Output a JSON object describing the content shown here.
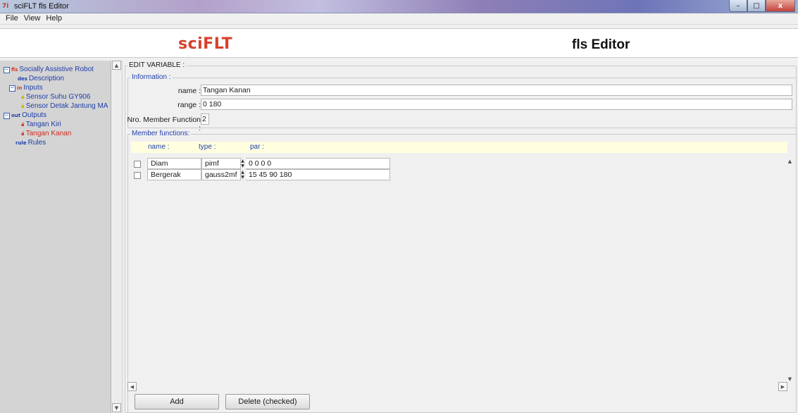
{
  "window": {
    "title": "sciFLT fls Editor",
    "min": "–",
    "max": "□",
    "close": "x"
  },
  "menu": [
    "File",
    "View",
    "Help"
  ],
  "banner": {
    "brand": "sciFLT",
    "editor_title": "fls Editor"
  },
  "tree": {
    "root": {
      "icon": "fls",
      "label": "Socially Assistive Robot"
    },
    "description": {
      "icon": "des",
      "label": "Description"
    },
    "inputs": {
      "icon": "in",
      "label": "Inputs"
    },
    "input_items": [
      "Sensor Suhu GY906",
      "Sensor Detak Jantung MA"
    ],
    "outputs": {
      "icon": "out",
      "label": "Outputs"
    },
    "output_items": [
      "Tangan Kiri",
      "Tangan Kanan"
    ],
    "rules": {
      "icon": "rule",
      "label": "Rules"
    }
  },
  "editor": {
    "section": "EDIT VARIABLE :",
    "information": "Information :",
    "name_label": "name :",
    "name_value": "Tangan Kanan",
    "range_label": "range :",
    "range_value": "0 180",
    "nmf_label": "Nro. Member Function :",
    "nmf_value": "2",
    "member_functions": "Member functions:",
    "columns": {
      "name": "name :",
      "type": "type :",
      "par": "par :"
    },
    "rows": [
      {
        "name": "Diam",
        "type": "pimf",
        "par": "0 0 0 0"
      },
      {
        "name": "Bergerak",
        "type": "gauss2mf",
        "par": "15 45 90 180"
      }
    ]
  },
  "buttons": {
    "add": "Add",
    "delete": "Delete (checked)"
  },
  "colors": {
    "brand": "#d9402c",
    "header_bg": "#ffffe0",
    "tree_link": "#1f3ea8",
    "tree_selected": "#cc2b1f"
  }
}
